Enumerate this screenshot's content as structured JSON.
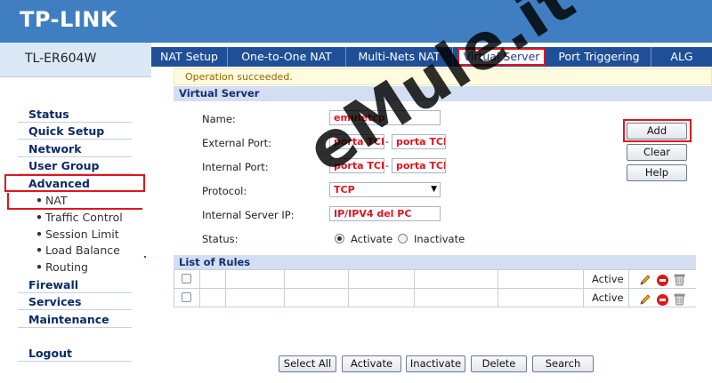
{
  "header": {
    "logo": "TP-LINK",
    "model": "TL-ER604W"
  },
  "colors": {
    "header": "#3f7fc1",
    "tab_bar": "#1f4f97",
    "highlight": "#e0151e",
    "section": "#d4def2"
  },
  "sidebar": {
    "items": [
      {
        "label": "Status"
      },
      {
        "label": "Quick Setup"
      },
      {
        "label": "Network"
      },
      {
        "label": "User Group"
      },
      {
        "label": "Advanced"
      },
      {
        "label": "NAT",
        "sub": true
      },
      {
        "label": "Traffic Control",
        "sub": true
      },
      {
        "label": "Session Limit",
        "sub": true
      },
      {
        "label": "Load Balance",
        "sub": true
      },
      {
        "label": "Routing",
        "sub": true
      },
      {
        "label": "Firewall"
      },
      {
        "label": "Services"
      },
      {
        "label": "Maintenance"
      },
      {
        "label": "Logout"
      }
    ],
    "sub_bullet": "•"
  },
  "tabs": [
    {
      "label": "NAT Setup"
    },
    {
      "label": "One-to-One NAT"
    },
    {
      "label": "Multi-Nets NAT"
    },
    {
      "label": "Virtual Server",
      "active": true
    },
    {
      "label": "Port Triggering"
    },
    {
      "label": "ALG"
    }
  ],
  "message": "Operation succeeded.",
  "virtual_server": {
    "title": "Virtual Server",
    "fields": {
      "name_label": "Name:",
      "name_value": "emuletcp",
      "ext_label": "External Port:",
      "ext_start": "porta TCP",
      "ext_end": "porta TCP",
      "int_label": "Internal Port:",
      "int_start": "porta TCP",
      "int_end": "porta TCP",
      "port_sep": "-",
      "protocol_label": "Protocol:",
      "protocol_value": "TCP",
      "ip_label": "Internal Server IP:",
      "ip_value": "IP/IPV4 del PC",
      "status_label": "Status:",
      "status_activate": "Activate",
      "status_inactivate": "Inactivate",
      "status_selected": "Activate"
    },
    "buttons": {
      "add": "Add",
      "clear": "Clear",
      "help": "Help"
    }
  },
  "rules": {
    "title": "List of Rules",
    "rows": [
      {
        "status": "Active"
      },
      {
        "status": "Active"
      }
    ]
  },
  "bottom_buttons": {
    "select_all": "Select All",
    "activate": "Activate",
    "inactivate": "Inactivate",
    "delete": "Delete",
    "search": "Search"
  },
  "watermark": "eMule.it"
}
